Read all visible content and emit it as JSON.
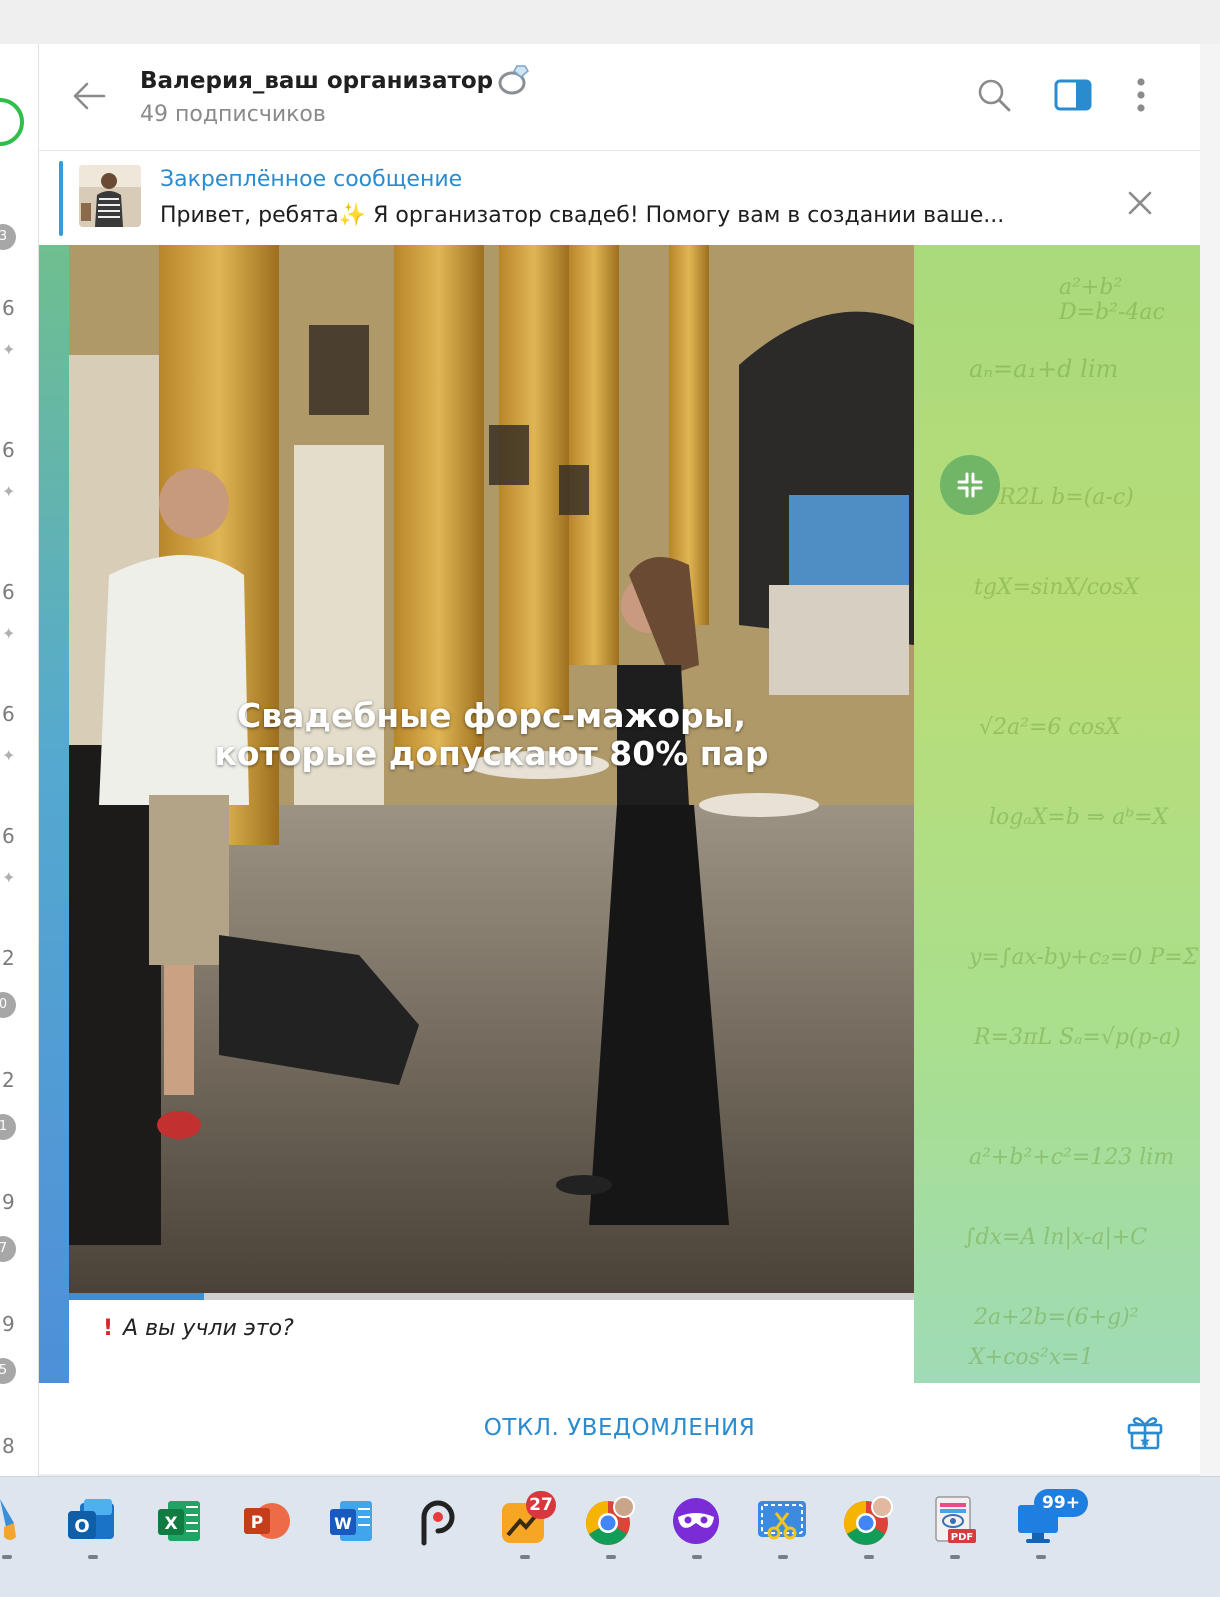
{
  "channel": {
    "title": "Валерия_ваш организатор",
    "subscribers": "49 подписчиков"
  },
  "header_icons": [
    "back-arrow-icon",
    "search-icon",
    "sidebar-toggle-icon",
    "more-vert-icon"
  ],
  "pinned": {
    "title": "Закреплённое сообщение",
    "text_a": "Привет, ребята",
    "text_b": " Я организатор свадеб!  Помогу вам в создании ваше..."
  },
  "video": {
    "caption_line1": "Свадебные форс-мажоры,",
    "caption_line2": "которые допускают 80% пар",
    "progress": 0.16
  },
  "message": {
    "text": "А вы учли это?"
  },
  "bottom": {
    "mute_label": "ОТКЛ. УВЕДОМЛЕНИЯ"
  },
  "left_list": {
    "counts": [
      "3",
      "6",
      "6",
      "6",
      "6",
      "6",
      "2",
      "0",
      "2",
      "1",
      "9",
      "7",
      "9",
      "5",
      "8"
    ]
  },
  "taskbar": {
    "apps": [
      "paint-brush-app",
      "outlook",
      "excel",
      "powerpoint",
      "word",
      "picsart",
      "weather-app",
      "chrome-profile-1",
      "vpn-app",
      "snipping-tool",
      "chrome-profile-2",
      "pdf-viewer",
      "windows-update"
    ],
    "badge_weather": "27",
    "badge_update": "99+"
  },
  "colors": {
    "accent": "#2a8ccf",
    "progress": "#3a8fd6",
    "alert": "#d9262c"
  }
}
